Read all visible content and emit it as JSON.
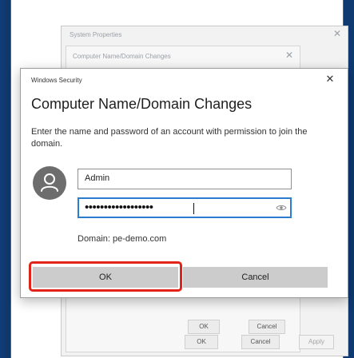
{
  "system_properties": {
    "title": "System Properties",
    "buttons": [
      "OK",
      "Cancel",
      "Apply"
    ]
  },
  "background_dialog": {
    "title": "Computer Name/Domain Changes",
    "buttons": [
      "OK",
      "Cancel"
    ]
  },
  "dialog": {
    "caption": "Windows Security",
    "heading": "Computer Name/Domain Changes",
    "description": "Enter the name and password of an account with permission to join the domain.",
    "username_value": "Admin",
    "password_masked": "••••••••••••••••••",
    "domain_text": "Domain: pe-demo.com",
    "ok_label": "OK",
    "cancel_label": "Cancel",
    "close_glyph": "✕"
  },
  "icons": {
    "avatar": "user-avatar-icon",
    "reveal": "reveal-password-icon"
  },
  "colors": {
    "accent": "#2b7bd1",
    "highlight": "#e2231a",
    "button_gray": "#cccccc",
    "desktop_blue": "#123d78"
  }
}
